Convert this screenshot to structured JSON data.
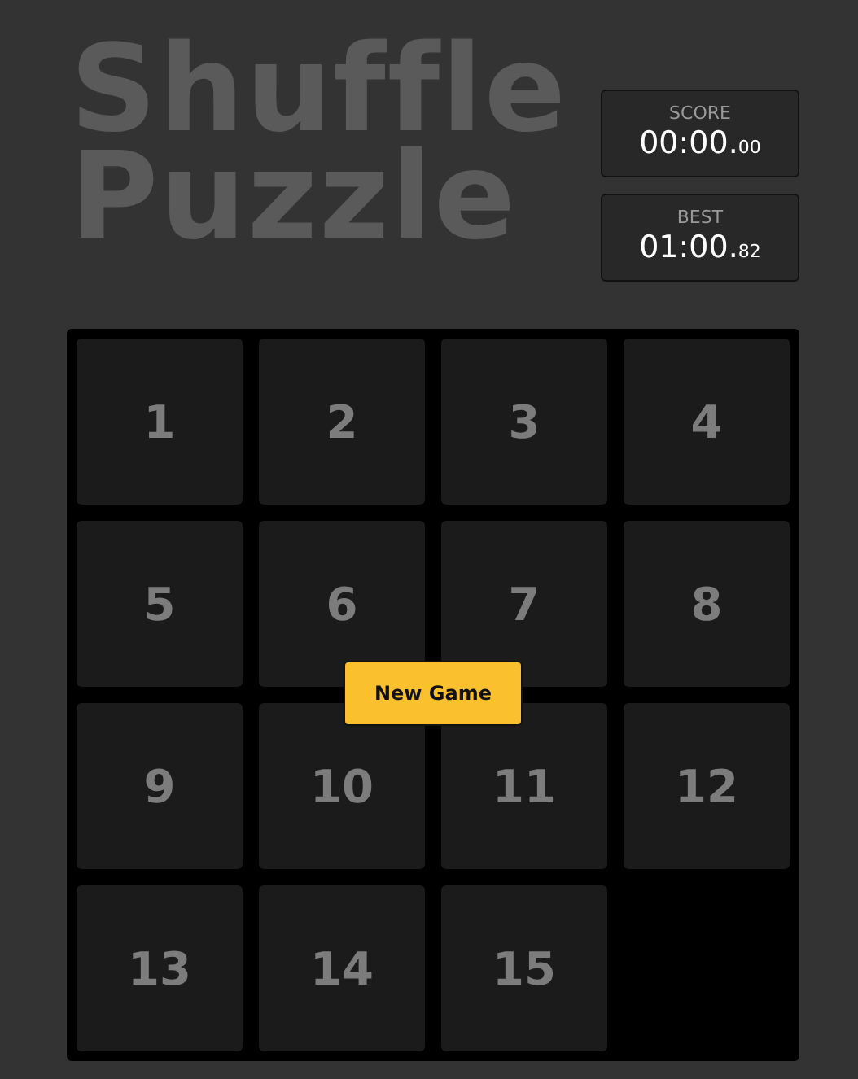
{
  "title": [
    "Shuffle",
    "Puzzle"
  ],
  "stats": [
    {
      "label": "SCORE",
      "time": "00:00.",
      "fraction": "00"
    },
    {
      "label": "BEST",
      "time": "01:00.",
      "fraction": "82"
    }
  ],
  "tiles": [
    {
      "kind": "tile",
      "label": "1"
    },
    {
      "kind": "tile",
      "label": "2"
    },
    {
      "kind": "tile",
      "label": "3"
    },
    {
      "kind": "tile",
      "label": "4"
    },
    {
      "kind": "tile",
      "label": "5"
    },
    {
      "kind": "tile",
      "label": "6"
    },
    {
      "kind": "tile",
      "label": "7"
    },
    {
      "kind": "tile",
      "label": "8"
    },
    {
      "kind": "tile",
      "label": "9"
    },
    {
      "kind": "tile",
      "label": "10"
    },
    {
      "kind": "tile",
      "label": "11"
    },
    {
      "kind": "tile",
      "label": "12"
    },
    {
      "kind": "tile",
      "label": "13"
    },
    {
      "kind": "tile",
      "label": "14"
    },
    {
      "kind": "tile",
      "label": "15"
    },
    {
      "kind": "empty"
    }
  ],
  "new_game_button": "New Game"
}
